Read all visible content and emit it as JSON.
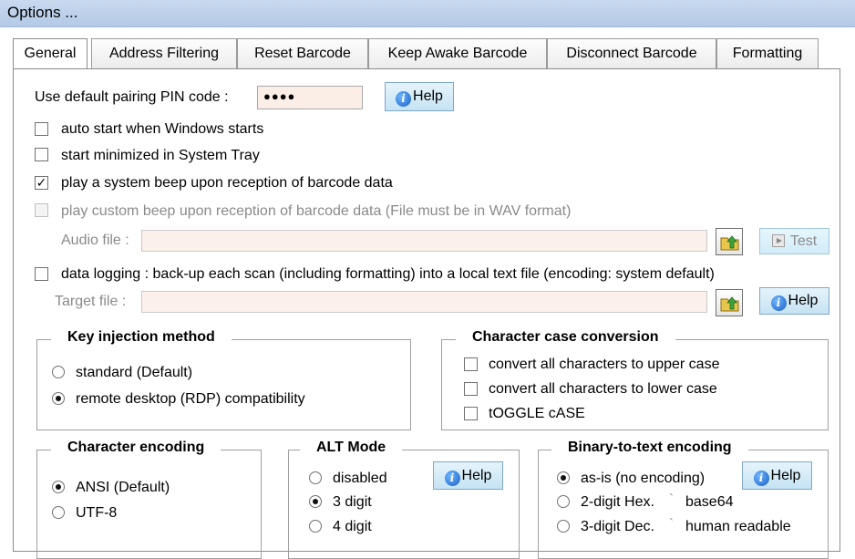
{
  "window": {
    "title": "Options ..."
  },
  "tabs": [
    {
      "label": "General",
      "active": true
    },
    {
      "label": "Address Filtering"
    },
    {
      "label": "Reset Barcode"
    },
    {
      "label": "Keep Awake Barcode"
    },
    {
      "label": "Disconnect Barcode"
    },
    {
      "label": "Formatting"
    }
  ],
  "general": {
    "pin_label": "Use default pairing PIN code :",
    "pin_value": "●●●●",
    "help_label": "Help",
    "options": {
      "auto_start": {
        "label": "auto start when Windows starts",
        "checked": false
      },
      "start_minimized": {
        "label": "start minimized in System Tray",
        "checked": false
      },
      "system_beep": {
        "label": "play a system beep upon reception of barcode data",
        "checked": true
      },
      "custom_beep": {
        "label": "play custom beep upon reception of barcode data (File must be in WAV format)",
        "checked": false,
        "enabled": false
      },
      "data_logging": {
        "label": "data logging : back-up each scan (including formatting) into a local text file (encoding: system default)",
        "checked": false
      }
    },
    "audio_file_label": "Audio file :",
    "audio_file_value": "",
    "test_label": "Test",
    "target_file_label": "Target file :",
    "target_file_value": "",
    "check_mark": "✓"
  },
  "key_injection": {
    "title": "Key injection method",
    "options": [
      {
        "label": "standard (Default)",
        "selected": false
      },
      {
        "label": "remote desktop (RDP) compatibility",
        "selected": true
      }
    ]
  },
  "case_conversion": {
    "title": "Character case conversion",
    "options": [
      {
        "label": "convert all characters to upper case",
        "checked": false
      },
      {
        "label": "convert all characters to lower case",
        "checked": false
      },
      {
        "label": "tOGGLE cASE",
        "checked": false
      }
    ]
  },
  "char_encoding": {
    "title": "Character encoding",
    "options": [
      {
        "label": "ANSI (Default)",
        "selected": true
      },
      {
        "label": "UTF-8",
        "selected": false
      }
    ]
  },
  "alt_mode": {
    "title": "ALT Mode",
    "options": [
      {
        "label": "disabled",
        "selected": false
      },
      {
        "label": "3 digit",
        "selected": true
      },
      {
        "label": "4 digit",
        "selected": false
      }
    ]
  },
  "binary_encoding": {
    "title": "Binary-to-text encoding",
    "options": [
      {
        "label": "as-is (no encoding)",
        "selected": true
      },
      {
        "label": "2-digit Hex.",
        "selected": false
      },
      {
        "label": "base64",
        "selected": false
      },
      {
        "label": "3-digit Dec.",
        "selected": false
      },
      {
        "label": "human readable",
        "selected": false
      }
    ],
    "separator": "`"
  },
  "colors": {
    "title_bar": "#c9daef",
    "field_background": "#fbeee6",
    "help_button": "#c5e3f3",
    "info_icon": "#1a5fc4"
  },
  "icons": {
    "help": "info-icon",
    "browse": "folder-arrow-icon",
    "test": "play-icon"
  }
}
